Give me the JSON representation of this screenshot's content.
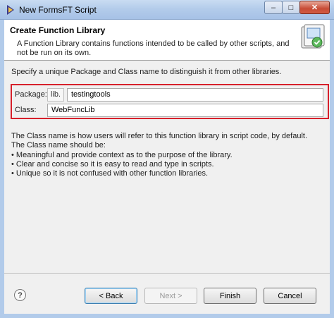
{
  "window": {
    "title": "New FormsFT Script",
    "min_glyph": "–",
    "max_glyph": "□",
    "close_glyph": "✕"
  },
  "banner": {
    "title": "Create Function Library",
    "description": "A Function Library contains functions intended to be called by other scripts, and not be run on its own."
  },
  "content": {
    "intro": "Specify a unique Package and Class name to distinguish it from other libraries.",
    "package_label": "Package:",
    "package_prefix": "lib.",
    "package_value": "testingtools",
    "class_label": "Class:",
    "class_value": "WebFuncLib",
    "help_text": "The Class name is how users will refer to this function library in script code, by default.  The Class name should be:",
    "help_bullets": [
      "• Meaningful and provide context as to the purpose of the library.",
      "• Clear and concise so it is easy to read and type in scripts.",
      "• Unique so it is not confused with other function libraries."
    ]
  },
  "buttons": {
    "help": "?",
    "back": "< Back",
    "next": "Next >",
    "finish": "Finish",
    "cancel": "Cancel"
  },
  "colors": {
    "highlight_border": "#d7202b",
    "titlebar": "#b2cbea"
  }
}
